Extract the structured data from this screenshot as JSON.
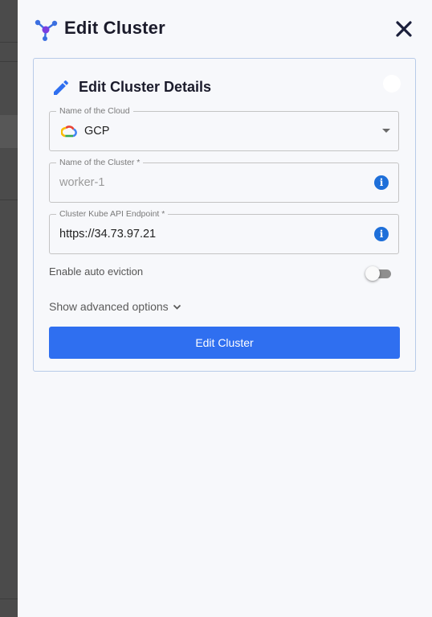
{
  "header": {
    "title": "Edit Cluster",
    "logo_icon": "cluster-nodes-icon",
    "close_icon": "close-icon"
  },
  "card": {
    "title": "Edit Cluster Details",
    "title_icon": "pencil-icon",
    "fields": {
      "cloud": {
        "label": "Name of the Cloud",
        "value": "GCP",
        "icon": "google-cloud-icon"
      },
      "cluster_name": {
        "label": "Name of the Cluster *",
        "value": "worker-1",
        "disabled": true
      },
      "endpoint": {
        "label": "Cluster Kube API Endpoint *",
        "value": "https://34.73.97.21"
      }
    },
    "auto_eviction": {
      "label": "Enable auto eviction",
      "enabled": false
    },
    "advanced_label": "Show advanced options",
    "submit_label": "Edit Cluster"
  },
  "colors": {
    "accent": "#2f6ff0",
    "info": "#1e6fd9",
    "title": "#1b1b2b",
    "card_border": "#b8cbe8"
  }
}
